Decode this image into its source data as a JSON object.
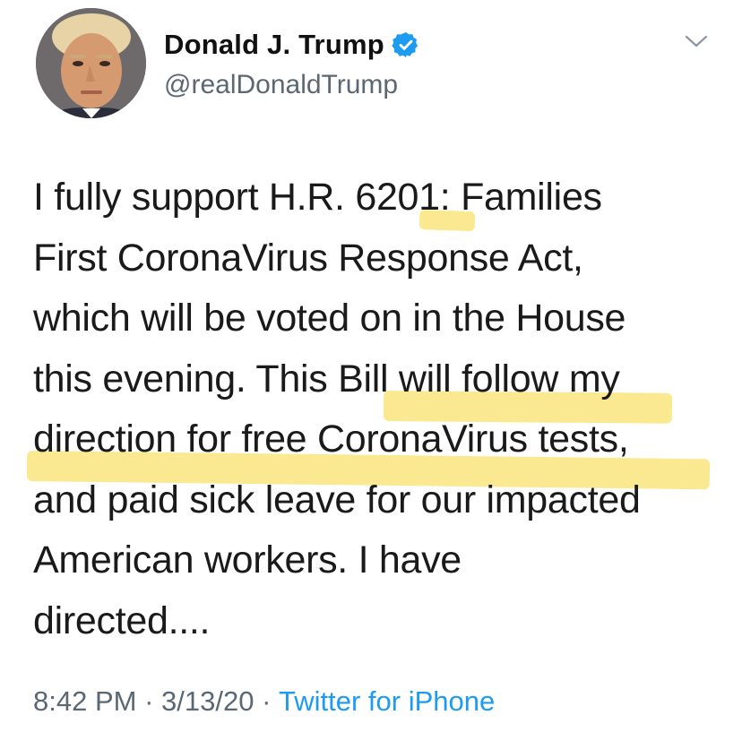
{
  "author": {
    "display_name": "Donald J. Trump",
    "handle": "@realDonaldTrump",
    "verified": true
  },
  "tweet": {
    "text": "I fully support H.R. 6201: Families\nFirst CoronaVirus Response Act,\nwhich will be voted on in the House\nthis evening. This Bill will follow my\ndirection for free CoronaVirus tests,\nand paid sick leave for our impacted\nAmerican workers. I have\ndirected...."
  },
  "meta": {
    "time": "8:42 PM",
    "separator": " · ",
    "date": "3/13/20",
    "source": "Twitter for iPhone"
  },
  "colors": {
    "verified_badge": "#1d9bf0",
    "highlighter": "#fae26e",
    "link": "#1d9bf0"
  },
  "icons": {
    "verified": "verified-badge-icon",
    "menu": "chevron-down-icon"
  }
}
